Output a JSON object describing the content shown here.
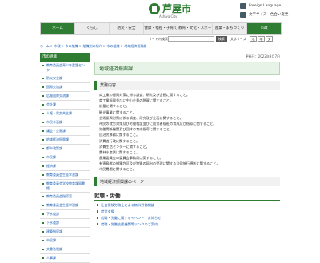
{
  "header": {
    "site_name": "芦屋市",
    "site_sub": "Ashiya City",
    "links": [
      "Foreign Language",
      "文字サイズ・色合い変更"
    ]
  },
  "nav": [
    "ホーム",
    "くらし",
    "防災・安全",
    "健康・福祉・子育て",
    "教育・文化・スポーツ",
    "産業・まちづくり",
    "市政"
  ],
  "toolbar": {
    "label": "サイト内検索",
    "search_placeholder": "",
    "search_button": "検索",
    "size_label": "文字サイズ",
    "size_small": "小",
    "size_mid": "中",
    "size_large": "大"
  },
  "breadcrumb": "ホーム > 市政 > 市の組織 > 組織別の紹介 > 市の組織 > 地域経済振興課",
  "sidebar": {
    "title": "市の組織",
    "items": [
      "教育委員会青少年愛護センター",
      "防災安全課",
      "国際交流課",
      "広報国際交流課",
      "会計課",
      "人権・男女共生課",
      "市民参画課",
      "議会・企画課",
      "地域経済振興課",
      "都市政策課",
      "市民課",
      "経済課",
      "教育委員会生涯学習課",
      "教育委員会学校教育課図書館",
      "教育委員会指導室",
      "教育委員会生涯学習課",
      "下水道課",
      "下水道課",
      "建築指導課",
      "市民課",
      "文書法制課",
      "人事課"
    ]
  },
  "main": {
    "meta": "更新日：2022年9月7日",
    "title": "地域経済振興課",
    "duties_head": "業務内容",
    "duties": [
      "商工業の振興対策に係る調査、研究及び企画に関すること。",
      "商工業振興並びに中小企業の融資に関すること。",
      "計量に関すること。",
      "観光事業に関すること。",
      "芸術振興対策に係る調査、研究及び企画に関すること。",
      "市民の就労対策及び労働相談並びに勤労者福祉の育成及び指導に関すること。",
      "労働関係機関及び団体の育成指導に関すること。",
      "自治労厚務に関すること。",
      "消費者行政に関すること。",
      "消費生活センターに関すること。",
      "農林水産業に関すること。",
      "農業委員会の委員会事務局に関すること。",
      "有害鳥獣の捕獲許可及び狩猟の届出の受理に関する法律施行規則に関すること。",
      "市民農園に関すること。"
    ],
    "pages_head": "地域経済振興課のページ",
    "sub_head": "就職・労働",
    "links": [
      "社会保険労務士による無料労働相談",
      "就労支援",
      "就職・労働に関するイベント・お知らせ",
      "就職・労働支援機関等リンクのご案内"
    ]
  }
}
